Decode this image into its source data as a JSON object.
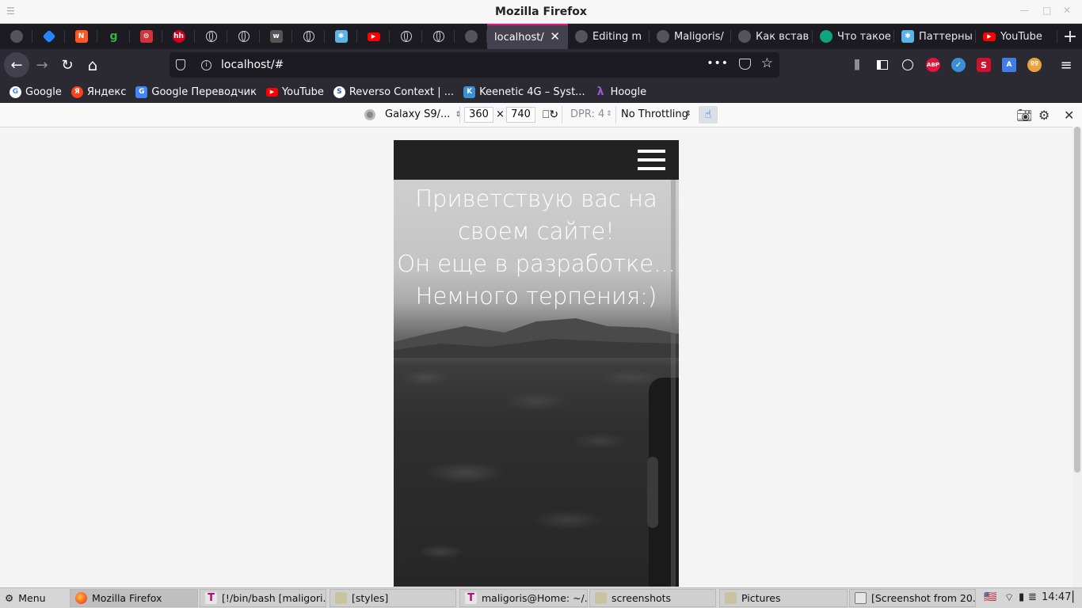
{
  "window": {
    "title": "Mozilla Firefox"
  },
  "tabs": {
    "icon_tabs": [
      {
        "name": "github-icon",
        "color": "#55545c"
      },
      {
        "name": "jira-icon",
        "color": "#2684ff"
      },
      {
        "name": "tab-icon-orange",
        "color": "#ff5722"
      },
      {
        "name": "tab-icon-g",
        "color": "#1c1b22"
      },
      {
        "name": "tab-icon-red",
        "color": "#d1343a"
      },
      {
        "name": "hh-icon",
        "color": "#d6001c"
      },
      {
        "name": "globe-icon",
        "color": ""
      },
      {
        "name": "globe-icon",
        "color": ""
      },
      {
        "name": "tab-icon-dark",
        "color": "#555"
      },
      {
        "name": "globe-icon",
        "color": ""
      },
      {
        "name": "tab-icon-blue",
        "color": "#5ab4e8"
      },
      {
        "name": "youtube-icon",
        "color": "#ff0000"
      },
      {
        "name": "globe-icon",
        "color": ""
      },
      {
        "name": "globe-icon",
        "color": ""
      },
      {
        "name": "github-icon",
        "color": "#55545c"
      }
    ],
    "active": {
      "label": "localhost/",
      "close": "✕"
    },
    "named": [
      {
        "label": "Editing m"
      },
      {
        "label": "Maligoris/"
      },
      {
        "label": "Как встав"
      },
      {
        "label": "Что такое"
      },
      {
        "label": "Паттерны"
      },
      {
        "label": "YouTube"
      }
    ],
    "new_tab": "+"
  },
  "navbar": {
    "url": "localhost/#",
    "back": "←",
    "forward": "→",
    "reload": "↻",
    "home": "⌂",
    "page_actions": "•••",
    "star": "☆"
  },
  "extensions": {
    "abp": "ABP",
    "s": "S",
    "hamburger": "≡"
  },
  "bookmarks": [
    {
      "label": "Google",
      "icon": "G",
      "color": "#4285f4"
    },
    {
      "label": "Яндекс",
      "icon": "Я",
      "color": "#fc3f1d"
    },
    {
      "label": "Google Переводчик",
      "icon": "G",
      "color": "#4285f4"
    },
    {
      "label": "YouTube",
      "icon": "▶",
      "color": "#ff0000"
    },
    {
      "label": "Reverso Context | ...",
      "icon": "S",
      "color": "#2a5caa"
    },
    {
      "label": "Keenetic 4G – Syst...",
      "icon": "K",
      "color": "#3b8fd6"
    },
    {
      "label": "Hoogle",
      "icon": "λ",
      "color": "#7a3e9d"
    }
  ],
  "rdm": {
    "device": "Galaxy S9/...",
    "width": "360",
    "times": "×",
    "height": "740",
    "dpr": "DPR: 4",
    "throttling": "No Throttling",
    "close": "✕"
  },
  "site": {
    "hero_lines": [
      "Приветствую вас на",
      "своем сайте!",
      "Он еще в разработке...",
      "Немного терпения:)"
    ]
  },
  "taskbar": {
    "menu": "Menu",
    "items": [
      {
        "label": "Mozilla Firefox"
      },
      {
        "label": "[!/bin/bash [maligori..."
      },
      {
        "label": "[styles]"
      },
      {
        "label": "maligoris@Home: ~/..."
      },
      {
        "label": "screenshots"
      },
      {
        "label": "Pictures"
      },
      {
        "label": "[Screenshot from 20..."
      }
    ],
    "time": "14:47"
  }
}
